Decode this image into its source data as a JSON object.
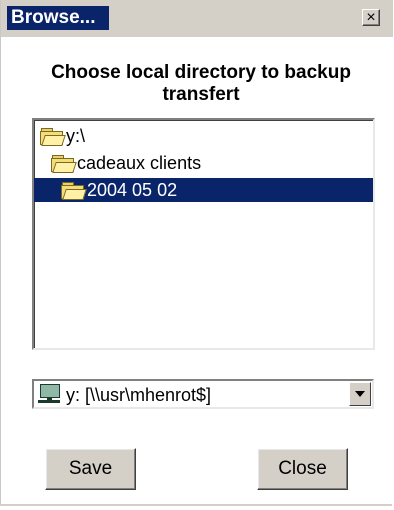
{
  "window": {
    "title": "Browse...",
    "close_glyph": "×"
  },
  "prompt": "Choose local directory to backup transfert",
  "tree": {
    "items": [
      {
        "label": "y:\\",
        "icon": "open-folder-icon",
        "selected": false
      },
      {
        "label": "cadeaux clients",
        "icon": "open-folder-icon",
        "selected": false
      },
      {
        "label": "2004 05 02",
        "icon": "open-folder-icon",
        "selected": true
      }
    ]
  },
  "drive": {
    "value": "y: [\\\\usr\\mhenrot$]",
    "icon": "network-drive-icon"
  },
  "buttons": {
    "save_label": "Save",
    "close_label": "Close"
  },
  "colors": {
    "titlebar_active": "#0a246a",
    "selection": "#0a246a",
    "face": "#d4d0c8"
  }
}
